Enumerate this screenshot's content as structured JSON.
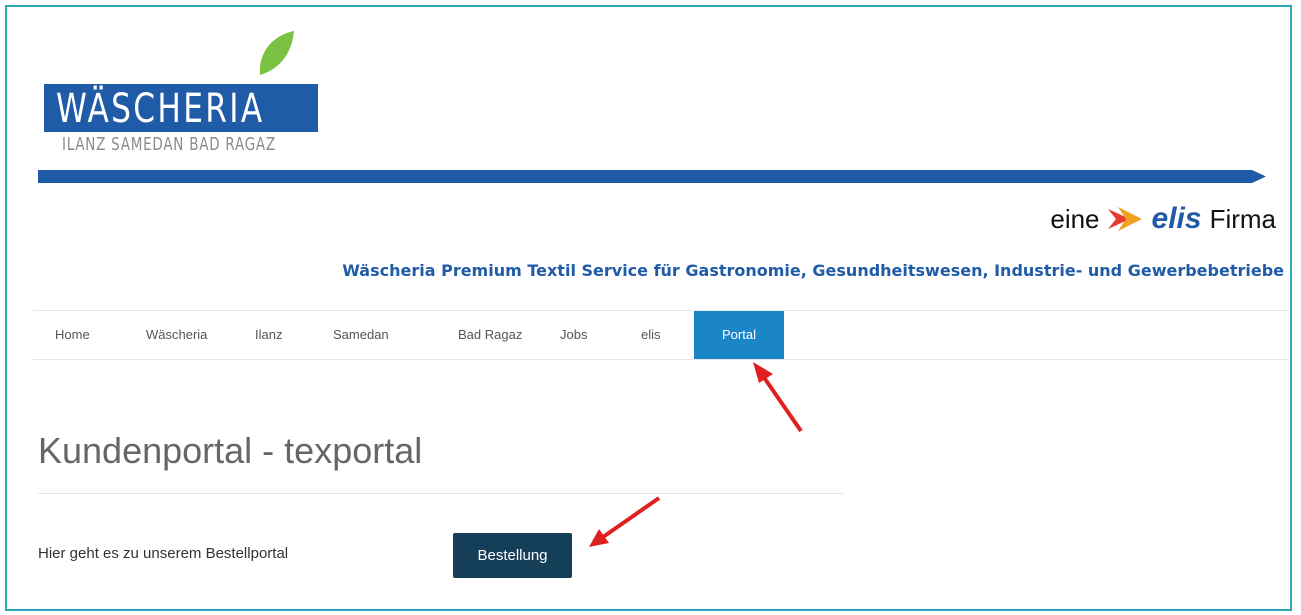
{
  "header": {
    "logo_word": "WÄSCHERIA",
    "logo_locations": "ILANZ SAMEDAN BAD RAGAZ",
    "elis_prefix": "eine",
    "elis_brand": "elis",
    "elis_suffix": "Firma",
    "tagline": "Wäscheria Premium Textil Service für Gastronomie, Gesundheitswesen, Industrie- und Gewerbebetriebe"
  },
  "nav": {
    "items": [
      {
        "label": "Home"
      },
      {
        "label": "Wäscheria"
      },
      {
        "label": "Ilanz"
      },
      {
        "label": "Samedan"
      },
      {
        "label": "Bad Ragaz"
      },
      {
        "label": "Jobs"
      },
      {
        "label": "elis"
      },
      {
        "label": "Portal"
      }
    ],
    "active_index": 7
  },
  "main": {
    "title": "Kundenportal - texportal",
    "intro": "Hier geht es zu unserem Bestellportal",
    "order_button": "Bestellung"
  },
  "colors": {
    "brand_blue": "#1f5ba6",
    "nav_active": "#1a86c8",
    "button_dark": "#153e58",
    "leaf_green": "#7cc242",
    "annotation_red": "#e02020",
    "frame": "#2aa8b8"
  },
  "icons": [
    "leaf-icon",
    "elis-swoosh-icon",
    "annotation-arrow-icon"
  ]
}
